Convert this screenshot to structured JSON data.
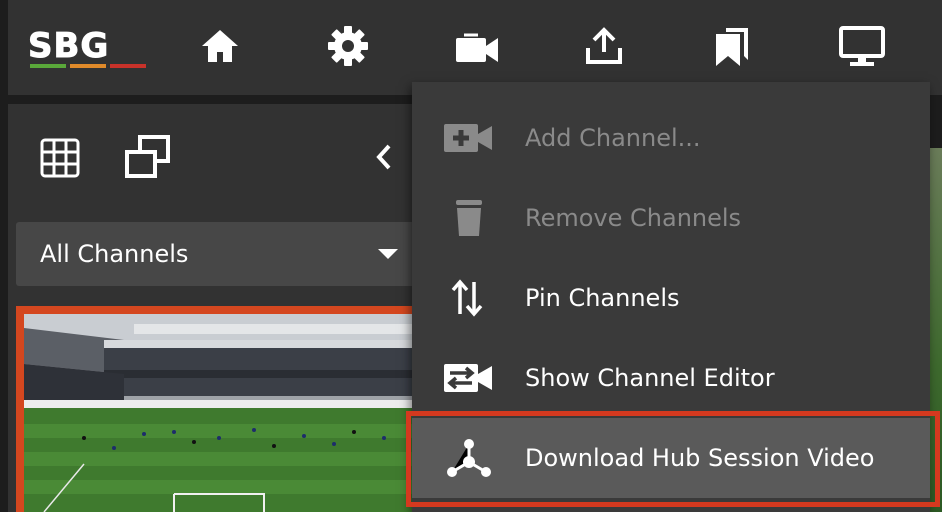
{
  "app": {
    "logo_text": "SBG",
    "logo_colors": [
      "#5aa83a",
      "#e08a2a",
      "#c8322a"
    ]
  },
  "toolbar": {
    "icons": [
      "home-icon",
      "gear-icon",
      "video-camera-icon",
      "upload-icon",
      "bookmarks-icon",
      "monitor-icon"
    ]
  },
  "left_panel": {
    "layout_icons": [
      "grid-view-icon",
      "overlap-windows-icon"
    ],
    "channel_filter": "All Channels"
  },
  "menu": {
    "items": [
      {
        "label": "Add Channel...",
        "icon": "add-video-icon",
        "enabled": false
      },
      {
        "label": "Remove Channels",
        "icon": "trash-icon",
        "enabled": false
      },
      {
        "label": "Pin Channels",
        "icon": "swap-vertical-icon",
        "enabled": true
      },
      {
        "label": "Show Channel Editor",
        "icon": "channel-editor-icon",
        "enabled": true
      },
      {
        "label": "Download Hub Session Video",
        "icon": "hub-network-icon",
        "enabled": true,
        "highlighted": true
      }
    ]
  },
  "colors": {
    "accent_red": "#d4391f",
    "toolbar_bg": "#323232",
    "menu_bg": "#3a3a3a",
    "disabled_text": "#8a8a8a"
  }
}
